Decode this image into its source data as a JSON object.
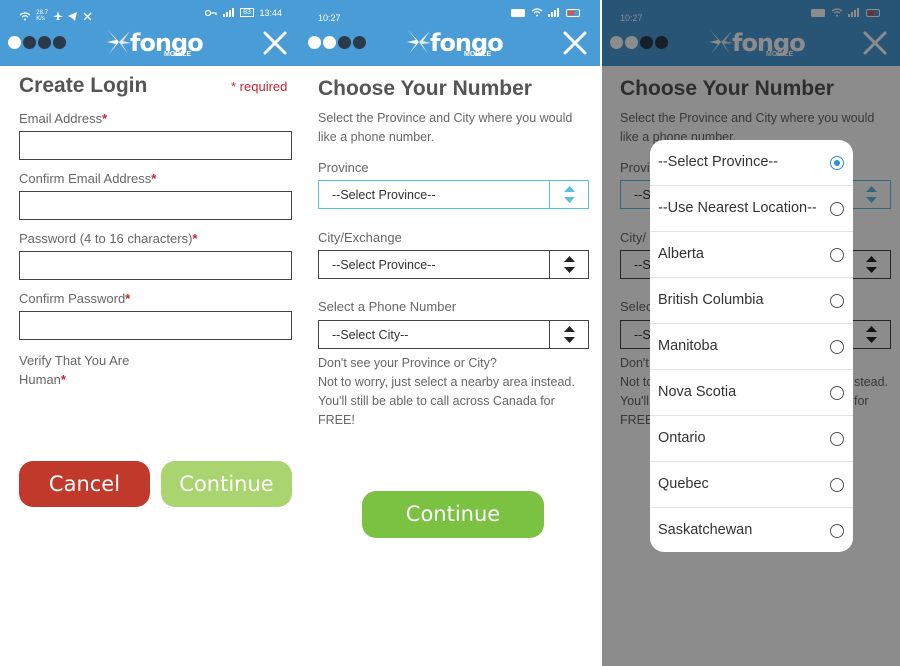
{
  "screens": [
    {
      "status": {
        "speed": "28.7\nK/s",
        "time": "13:44",
        "battery": "83"
      },
      "title": "Create Login",
      "required_note": "* required",
      "fields": [
        {
          "label": "Email Address",
          "star": "*",
          "value": ""
        },
        {
          "label": "Confirm Email Address",
          "star": "*",
          "value": ""
        },
        {
          "label": "Password (4 to 16 characters)",
          "star": "*",
          "value": ""
        },
        {
          "label": "Confirm Password",
          "star": "*",
          "value": ""
        }
      ],
      "verify_label_line1": "Verify That You Are",
      "verify_label_line2": "Human",
      "verify_star": "*",
      "cancel_label": "Cancel",
      "continue_label": "Continue"
    },
    {
      "status": {
        "time": "10:27"
      },
      "title": "Choose Your Number",
      "intro": "Select the Province and City where you would like a phone number.",
      "province_label": "Province",
      "province_value": "--Select Province--",
      "city_label": "City/Exchange",
      "city_value": "--Select Province--",
      "number_label": "Select a Phone Number",
      "number_value": "--Select City--",
      "help_line1": "Don't see your Province or City?",
      "help_line2": "Not to worry, just select a nearby area instead.",
      "help_line3": "You'll still be able to call across Canada for",
      "help_line4": "FREE!",
      "continue_label": "Continue"
    },
    {
      "status": {
        "time": "10:27"
      },
      "title": "Choose Your Number",
      "intro": "Select the Province and City where you would like a phone number.",
      "bg_province_label": "Provi",
      "bg_city_label": "City/",
      "bg_number_label": "Selec",
      "bg_select_fragment": "--S",
      "bg_help": [
        "Don't",
        "Not to",
        "You'll",
        "FREE"
      ],
      "bg_help_right": [
        "stead.",
        "for"
      ],
      "options": [
        {
          "label": "--Select Province--",
          "selected": true
        },
        {
          "label": "--Use Nearest Location--",
          "selected": false
        },
        {
          "label": "Alberta",
          "selected": false
        },
        {
          "label": "British Columbia",
          "selected": false
        },
        {
          "label": "Manitoba",
          "selected": false
        },
        {
          "label": "Nova Scotia",
          "selected": false
        },
        {
          "label": "Ontario",
          "selected": false
        },
        {
          "label": "Quebec",
          "selected": false
        },
        {
          "label": "Saskatchewan",
          "selected": false
        }
      ]
    }
  ],
  "brand": {
    "name": "fongo",
    "sub": "MOBILE",
    "bar_color": "#4a9cd6",
    "red": "#c0392b",
    "green": "#7bc142",
    "light_green": "#a9d46f",
    "radio_blue": "#2f8fd6"
  },
  "icons": {
    "close": "close-icon",
    "radio": "radio-button-icon",
    "select_arrow": "select-arrows-icon",
    "progress": "step-dots-icon"
  },
  "steps": {
    "screen1_active": 1,
    "screen2_active": 2,
    "screen3_active": 2,
    "total": 4
  }
}
